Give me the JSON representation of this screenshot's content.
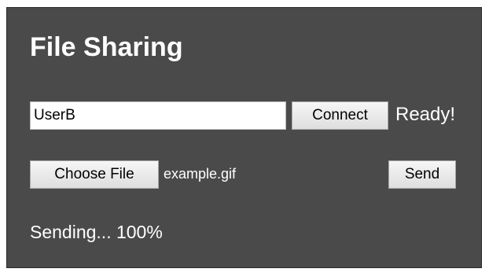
{
  "app": {
    "title": "File Sharing"
  },
  "connection": {
    "username_value": "UserB",
    "connect_label": "Connect",
    "status": "Ready!"
  },
  "file": {
    "choose_label": "Choose File",
    "selected_name": "example.gif",
    "send_label": "Send"
  },
  "transfer": {
    "status_text": "Sending... 100%",
    "percent": 100
  },
  "colors": {
    "panel_background": "#4a4a4a",
    "text": "#ffffff",
    "button_background": "#e6e6e6"
  }
}
